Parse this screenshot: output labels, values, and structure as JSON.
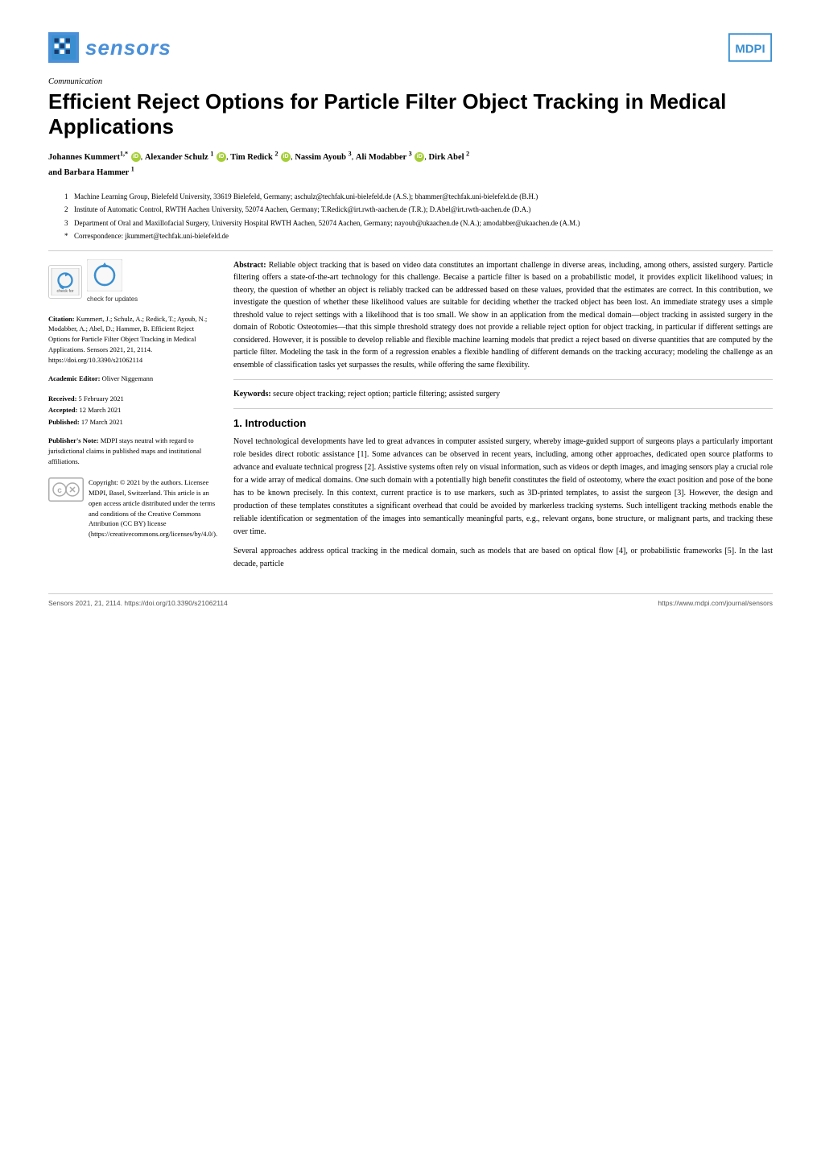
{
  "header": {
    "journal_name": "sensors",
    "mdpi_label": "MDPI"
  },
  "article": {
    "section_label": "Communication",
    "title": "Efficient Reject Options for Particle Filter Object Tracking in Medical Applications",
    "authors_line1": "Johannes Kummert",
    "authors_sup1": "1,*",
    "authors_a2": "Alexander Schulz",
    "authors_sup2": "1",
    "authors_a3": "Tim Redick",
    "authors_sup3": "2",
    "authors_a4": "Nassim Ayoub",
    "authors_sup4": "3",
    "authors_a5": "Ali Modabber",
    "authors_sup5": "3",
    "authors_a6": "Dirk Abel",
    "authors_sup6": "2",
    "authors_line2": "and Barbara Hammer",
    "authors_sup7": "1"
  },
  "affiliations": [
    {
      "num": "1",
      "text": "Machine Learning Group, Bielefeld University, 33619 Bielefeld, Germany; aschulz@techfak.uni-bielefeld.de (A.S.); bhammer@techfak.uni-bielefeld.de (B.H.)"
    },
    {
      "num": "2",
      "text": "Institute of Automatic Control, RWTH Aachen University, 52074 Aachen, Germany; T.Redick@irt.rwth-aachen.de (T.R.); D.Abel@irt.rwth-aachen.de (D.A.)"
    },
    {
      "num": "3",
      "text": "Department of Oral and Maxillofacial Surgery, University Hospital RWTH Aachen, 52074 Aachen, Germany; nayoub@ukaachen.de (N.A.); amodabber@ukaachen.de (A.M.)"
    },
    {
      "num": "*",
      "text": "Correspondence: jkummert@techfak.uni-bielefeld.de"
    }
  ],
  "check_updates": {
    "label": "check for\nupdates"
  },
  "citation": {
    "label": "Citation:",
    "text": "Kummert, J.; Schulz, A.; Redick, T.; Ayoub, N.; Modabber, A.; Abel, D.; Hammer, B. Efficient Reject Options for Particle Filter Object Tracking in Medical Applications. Sensors 2021, 21, 2114. https://doi.org/10.3390/s21062114"
  },
  "academic_editor": {
    "label": "Academic Editor:",
    "name": "Oliver Niggemann"
  },
  "dates": {
    "received_label": "Received:",
    "received": "5 February 2021",
    "accepted_label": "Accepted:",
    "accepted": "12 March 2021",
    "published_label": "Published:",
    "published": "17 March 2021"
  },
  "publisher_note": {
    "label": "Publisher's Note:",
    "text": "MDPI stays neutral with regard to jurisdictional claims in published maps and institutional affiliations."
  },
  "copyright": {
    "year": "2021",
    "text": "Copyright: © 2021 by the authors. Licensee MDPI, Basel, Switzerland. This article is an open access article distributed under the terms and conditions of the Creative Commons Attribution (CC BY) license (https://creativecommons.org/licenses/by/4.0/)."
  },
  "abstract": {
    "label": "Abstract:",
    "text": "Reliable object tracking that is based on video data constitutes an important challenge in diverse areas, including, among others, assisted surgery. Particle filtering offers a state-of-the-art technology for this challenge. Becaise a particle filter is based on a probabilistic model, it provides explicit likelihood values; in theory, the question of whether an object is reliably tracked can be addressed based on these values, provided that the estimates are correct. In this contribution, we investigate the question of whether these likelihood values are suitable for deciding whether the tracked object has been lost. An immediate strategy uses a simple threshold value to reject settings with a likelihood that is too small. We show in an application from the medical domain—object tracking in assisted surgery in the domain of Robotic Osteotomies—that this simple threshold strategy does not provide a reliable reject option for object tracking, in particular if different settings are considered. However, it is possible to develop reliable and flexible machine learning models that predict a reject based on diverse quantities that are computed by the particle filter. Modeling the task in the form of a regression enables a flexible handling of different demands on the tracking accuracy; modeling the challenge as an ensemble of classification tasks yet surpasses the results, while offering the same flexibility."
  },
  "keywords": {
    "label": "Keywords:",
    "text": "secure object tracking; reject option; particle filtering; assisted surgery"
  },
  "introduction": {
    "heading": "1. Introduction",
    "para1": "Novel technological developments have led to great advances in computer assisted surgery, whereby image-guided support of surgeons plays a particularly important role besides direct robotic assistance [1]. Some advances can be observed in recent years, including, among other approaches, dedicated open source platforms to advance and evaluate technical progress [2]. Assistive systems often rely on visual information, such as videos or depth images, and imaging sensors play a crucial role for a wide array of medical domains. One such domain with a potentially high benefit constitutes the field of osteotomy, where the exact position and pose of the bone has to be known precisely. In this context, current practice is to use markers, such as 3D-printed templates, to assist the surgeon [3]. However, the design and production of these templates constitutes a significant overhead that could be avoided by markerless tracking systems. Such intelligent tracking methods enable the reliable identification or segmentation of the images into semantically meaningful parts, e.g., relevant organs, bone structure, or malignant parts, and tracking these over time.",
    "para2": "Several approaches address optical tracking in the medical domain, such as models that are based on optical flow [4], or probabilistic frameworks [5]. In the last decade, particle"
  },
  "footer": {
    "journal_ref": "Sensors 2021, 21, 2114. https://doi.org/10.3390/s21062114",
    "url": "https://www.mdpi.com/journal/sensors"
  }
}
